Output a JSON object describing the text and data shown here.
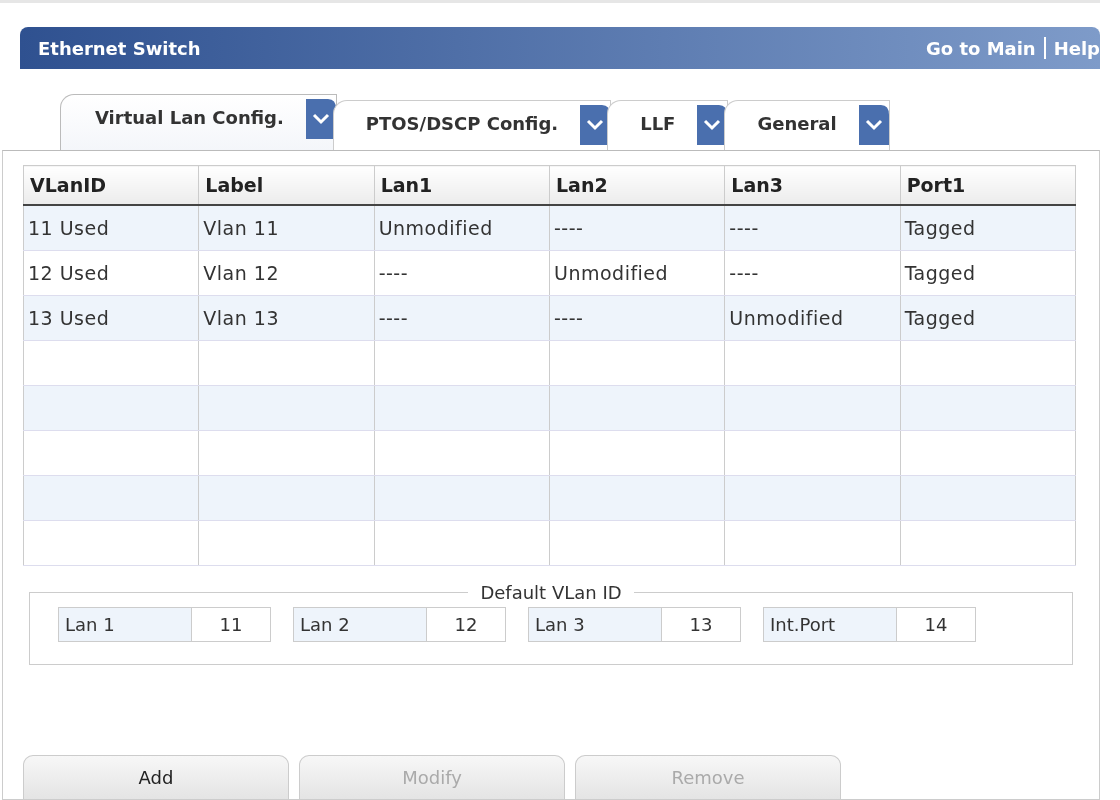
{
  "header": {
    "title": "Ethernet Switch",
    "links": [
      "Go to Main",
      "Help"
    ]
  },
  "tabs": [
    {
      "label": "Virtual Lan Config.",
      "selected": true
    },
    {
      "label": "PTOS/DSCP Config.",
      "selected": false
    },
    {
      "label": "LLF",
      "selected": false
    },
    {
      "label": "General",
      "selected": false
    }
  ],
  "table": {
    "columns": [
      "VLanID",
      "Label",
      "Lan1",
      "Lan2",
      "Lan3",
      "Port1"
    ],
    "rows": [
      [
        "11  Used",
        "Vlan 11",
        "Unmodified",
        "----",
        "----",
        "Tagged"
      ],
      [
        "12  Used",
        "Vlan 12",
        "----",
        "Unmodified",
        "----",
        "Tagged"
      ],
      [
        "13  Used",
        "Vlan 13",
        "----",
        "----",
        "Unmodified",
        "Tagged"
      ]
    ]
  },
  "default_vlan": {
    "title": "Default VLan ID",
    "fields": [
      {
        "label": "Lan 1",
        "value": "11"
      },
      {
        "label": "Lan 2",
        "value": "12"
      },
      {
        "label": "Lan 3",
        "value": "13"
      },
      {
        "label": "Int.Port",
        "value": "14"
      }
    ]
  },
  "buttons": [
    {
      "label": "Add",
      "disabled": false
    },
    {
      "label": "Modify",
      "disabled": true
    },
    {
      "label": "Remove",
      "disabled": true
    }
  ]
}
